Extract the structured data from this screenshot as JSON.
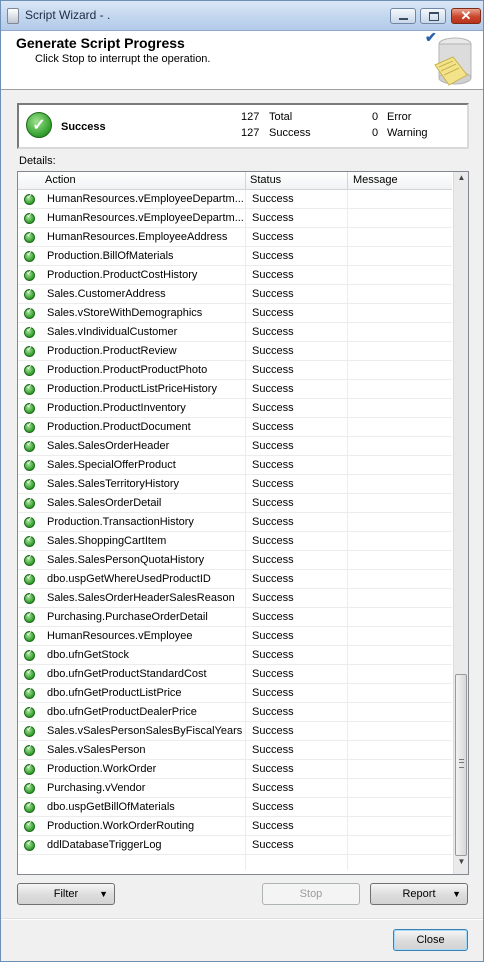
{
  "window": {
    "title": "Script Wizard - ."
  },
  "header": {
    "title": "Generate Script Progress",
    "subtitle": "Click Stop to interrupt the operation."
  },
  "summary": {
    "status": "Success",
    "total_count": "127",
    "total_label": "Total",
    "success_count": "127",
    "success_label": "Success",
    "error_count": "0",
    "error_label": "Error",
    "warning_count": "0",
    "warning_label": "Warning"
  },
  "details": {
    "label": "Details:",
    "columns": [
      "Action",
      "Status",
      "Message"
    ],
    "rows": [
      {
        "action": "HumanResources.vEmployeeDepartm...",
        "status": "Success",
        "message": ""
      },
      {
        "action": "HumanResources.vEmployeeDepartm...",
        "status": "Success",
        "message": ""
      },
      {
        "action": "HumanResources.EmployeeAddress",
        "status": "Success",
        "message": ""
      },
      {
        "action": "Production.BillOfMaterials",
        "status": "Success",
        "message": ""
      },
      {
        "action": "Production.ProductCostHistory",
        "status": "Success",
        "message": ""
      },
      {
        "action": "Sales.CustomerAddress",
        "status": "Success",
        "message": ""
      },
      {
        "action": "Sales.vStoreWithDemographics",
        "status": "Success",
        "message": ""
      },
      {
        "action": "Sales.vIndividualCustomer",
        "status": "Success",
        "message": ""
      },
      {
        "action": "Production.ProductReview",
        "status": "Success",
        "message": ""
      },
      {
        "action": "Production.ProductProductPhoto",
        "status": "Success",
        "message": ""
      },
      {
        "action": "Production.ProductListPriceHistory",
        "status": "Success",
        "message": ""
      },
      {
        "action": "Production.ProductInventory",
        "status": "Success",
        "message": ""
      },
      {
        "action": "Production.ProductDocument",
        "status": "Success",
        "message": ""
      },
      {
        "action": "Sales.SalesOrderHeader",
        "status": "Success",
        "message": ""
      },
      {
        "action": "Sales.SpecialOfferProduct",
        "status": "Success",
        "message": ""
      },
      {
        "action": "Sales.SalesTerritoryHistory",
        "status": "Success",
        "message": ""
      },
      {
        "action": "Sales.SalesOrderDetail",
        "status": "Success",
        "message": ""
      },
      {
        "action": "Production.TransactionHistory",
        "status": "Success",
        "message": ""
      },
      {
        "action": "Sales.ShoppingCartItem",
        "status": "Success",
        "message": ""
      },
      {
        "action": "Sales.SalesPersonQuotaHistory",
        "status": "Success",
        "message": ""
      },
      {
        "action": "dbo.uspGetWhereUsedProductID",
        "status": "Success",
        "message": ""
      },
      {
        "action": "Sales.SalesOrderHeaderSalesReason",
        "status": "Success",
        "message": ""
      },
      {
        "action": "Purchasing.PurchaseOrderDetail",
        "status": "Success",
        "message": ""
      },
      {
        "action": "HumanResources.vEmployee",
        "status": "Success",
        "message": ""
      },
      {
        "action": "dbo.ufnGetStock",
        "status": "Success",
        "message": ""
      },
      {
        "action": "dbo.ufnGetProductStandardCost",
        "status": "Success",
        "message": ""
      },
      {
        "action": "dbo.ufnGetProductListPrice",
        "status": "Success",
        "message": ""
      },
      {
        "action": "dbo.ufnGetProductDealerPrice",
        "status": "Success",
        "message": ""
      },
      {
        "action": "Sales.vSalesPersonSalesByFiscalYears",
        "status": "Success",
        "message": ""
      },
      {
        "action": "Sales.vSalesPerson",
        "status": "Success",
        "message": ""
      },
      {
        "action": "Production.WorkOrder",
        "status": "Success",
        "message": ""
      },
      {
        "action": "Purchasing.vVendor",
        "status": "Success",
        "message": ""
      },
      {
        "action": "dbo.uspGetBillOfMaterials",
        "status": "Success",
        "message": ""
      },
      {
        "action": "Production.WorkOrderRouting",
        "status": "Success",
        "message": ""
      },
      {
        "action": "ddlDatabaseTriggerLog",
        "status": "Success",
        "message": ""
      }
    ]
  },
  "buttons": {
    "filter": "Filter",
    "stop": "Stop",
    "report": "Report",
    "close": "Close"
  },
  "icons": {
    "status": "success-check-icon",
    "row": "success-check-icon",
    "header": "database-script-icon"
  },
  "colors": {
    "success_green": "#2f9d29",
    "title_bar": "#c2d6ee",
    "close_red": "#c9452b"
  }
}
